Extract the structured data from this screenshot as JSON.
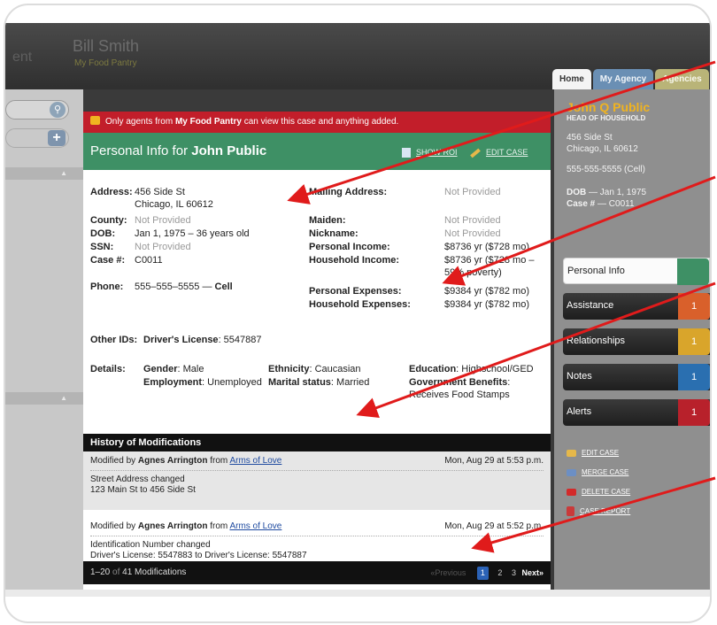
{
  "header": {
    "ghost_text": "ent",
    "user_name": "Bill Smith",
    "org_name": "My Food Pantry",
    "tabs": [
      "Home",
      "My Agency",
      "Agencies"
    ]
  },
  "alert": {
    "pre": "Only agents from",
    "org": "My Food Pantry",
    "post": "can view this case and anything added."
  },
  "panel": {
    "title_prefix": "Personal Info for",
    "title_name": "John Public",
    "show_roi": "SHOW ROI",
    "edit_case": "EDIT CASE"
  },
  "info": {
    "address_label": "Address:",
    "address_line1": "456 Side St",
    "address_line2": "Chicago, IL 60612",
    "county_label": "County:",
    "county": "Not Provided",
    "dob_label": "DOB:",
    "dob": "Jan 1, 1975 – 36 years old",
    "ssn_label": "SSN:",
    "ssn": "Not Provided",
    "case_label": "Case #:",
    "case": "C0011",
    "phone_label": "Phone:",
    "phone": "555–555–5555 —",
    "phone_type": "Cell",
    "mailing_label": "Mailing Address:",
    "mailing": "Not Provided",
    "maiden_label": "Maiden:",
    "maiden": "Not Provided",
    "nickname_label": "Nickname:",
    "nickname": "Not Provided",
    "personal_income_label": "Personal Income:",
    "personal_income": "$8736 yr ($728 mo)",
    "household_income_label": "Household Income:",
    "household_income": "$8736 yr ($728 mo –",
    "household_income_poverty": "59% poverty)",
    "personal_expenses_label": "Personal Expenses:",
    "personal_expenses": "$9384 yr ($782 mo)",
    "household_expenses_label": "Household Expenses:",
    "household_expenses": "$9384 yr ($782 mo)",
    "other_ids_label": "Other IDs:",
    "drivers_license_label": "Driver's License",
    "drivers_license": ": 5547887",
    "details_label": "Details:",
    "gender_label": "Gender",
    "gender": ": Male",
    "employment_label": "Employment",
    "employment": ": Unemployed",
    "ethnicity_label": "Ethnicity",
    "ethnicity": ": Caucasian",
    "marital_label": "Marital status",
    "marital": ": Married",
    "education_label": "Education",
    "education": ": Highschool/GED",
    "benefits_label": "Government Benefits",
    "benefits_colon": ":",
    "benefits": "Receives Food Stamps"
  },
  "history": {
    "title": "History of Modifications",
    "entries": [
      {
        "prefix": "Modified by",
        "agent": "Agnes Arrington",
        "from": "from",
        "org": "Arms of Love",
        "date": "Mon, Aug 29 at 5:53 p.m.",
        "detail1": "Street Address changed",
        "detail2": "123 Main St to 456 Side St"
      },
      {
        "prefix": "Modified by",
        "agent": "Agnes Arrington",
        "from": "from",
        "org": "Arms of Love",
        "date": "Mon, Aug 29 at 5:52 p.m.",
        "detail1": "Identification Number changed",
        "detail2": "Driver's License: 5547883 to Driver's License: 5547887"
      }
    ]
  },
  "footer": {
    "range": "1–20",
    "of": "of",
    "count": "41 Modifications",
    "prev": "«Previous",
    "pages": [
      "1",
      "2",
      "3"
    ],
    "next": "Next»"
  },
  "sidebar": {
    "name": "John Q Public",
    "role": "HEAD OF HOUSEHOLD",
    "addr1": "456 Side St",
    "addr2": "Chicago, IL  60612",
    "phone": "555-555-5555 (Cell)",
    "dob_label": "DOB",
    "dob": " — Jan 1, 1975",
    "case_label": "Case #",
    "case": " — C0011",
    "nav": [
      {
        "label": "Personal Info",
        "count": "",
        "color": "#3e9065"
      },
      {
        "label": "Assistance",
        "count": "1",
        "color": "#d9602b"
      },
      {
        "label": "Relationships",
        "count": "1",
        "color": "#d9a52b"
      },
      {
        "label": "Notes",
        "count": "1",
        "color": "#2a6fb0"
      },
      {
        "label": "Alerts",
        "count": "1",
        "color": "#b8212b"
      }
    ],
    "actions": [
      "EDIT CASE",
      "MERGE CASE",
      "DELETE CASE",
      "CASE REPORT"
    ]
  },
  "colors": {
    "alert_red": "#c21e2a",
    "header_green": "#3e9065",
    "annotation_arrow": "#e01b1b",
    "name_gold": "#f0b320"
  }
}
